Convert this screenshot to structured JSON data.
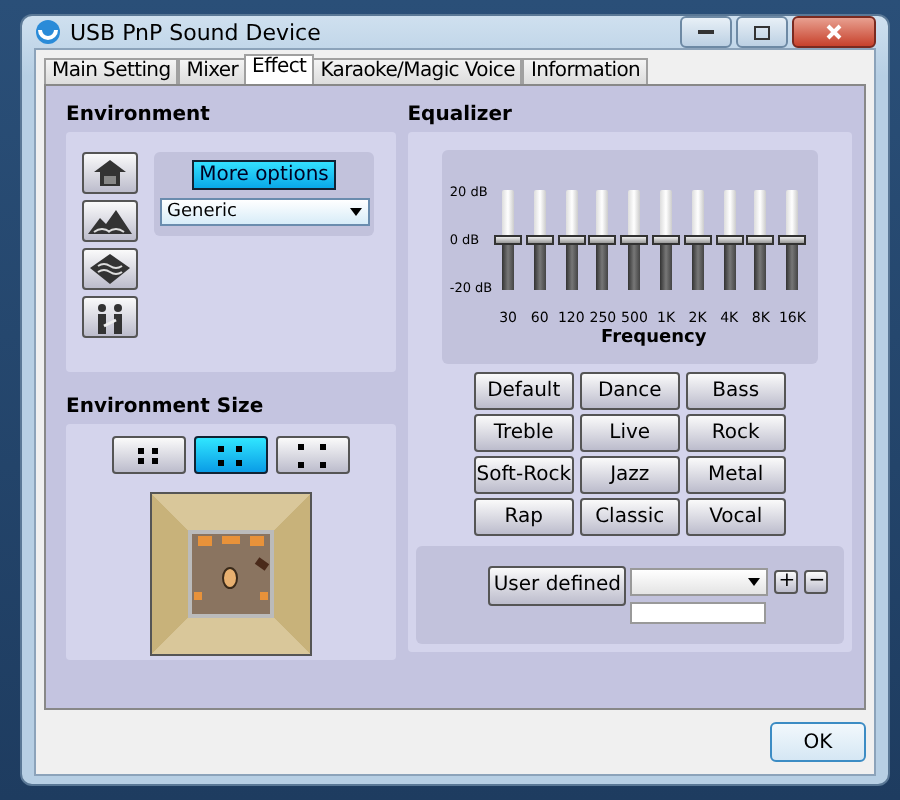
{
  "window": {
    "title": "USB PnP Sound Device"
  },
  "tabs": [
    {
      "label": "Main Setting",
      "selected": false
    },
    {
      "label": "Mixer",
      "selected": false
    },
    {
      "label": "Effect",
      "selected": true
    },
    {
      "label": "Karaoke/Magic Voice",
      "selected": false
    },
    {
      "label": "Information",
      "selected": false
    }
  ],
  "environment": {
    "title": "Environment",
    "presets": [
      {
        "kind": "house"
      },
      {
        "kind": "mountains"
      },
      {
        "kind": "waves"
      },
      {
        "kind": "people"
      }
    ],
    "more_options": "More options",
    "dropdown": {
      "value": "Generic"
    }
  },
  "environment_size": {
    "title": "Environment Size",
    "sizes": [
      {
        "kind": "small",
        "selected": false
      },
      {
        "kind": "medium",
        "selected": true
      },
      {
        "kind": "large",
        "selected": false
      }
    ]
  },
  "equalizer": {
    "title": "Equalizer",
    "scale": [
      "20 dB",
      "0 dB",
      "-20 dB"
    ],
    "bands": [
      {
        "label": "30",
        "level": 0.5
      },
      {
        "label": "60",
        "level": 0.5
      },
      {
        "label": "120",
        "level": 0.5
      },
      {
        "label": "250",
        "level": 0.5
      },
      {
        "label": "500",
        "level": 0.5
      },
      {
        "label": "1K",
        "level": 0.5
      },
      {
        "label": "2K",
        "level": 0.5
      },
      {
        "label": "4K",
        "level": 0.5
      },
      {
        "label": "8K",
        "level": 0.5
      },
      {
        "label": "16K",
        "level": 0.5
      }
    ],
    "axis_label": "Frequency",
    "presets": [
      "Default",
      "Dance",
      "Bass",
      "Treble",
      "Live",
      "Rock",
      "Soft-Rock",
      "Jazz",
      "Metal",
      "Rap",
      "Classic",
      "Vocal"
    ],
    "user_defined": {
      "button": "User defined",
      "add": "+",
      "remove": "−"
    }
  },
  "buttons": [
    "OK"
  ]
}
